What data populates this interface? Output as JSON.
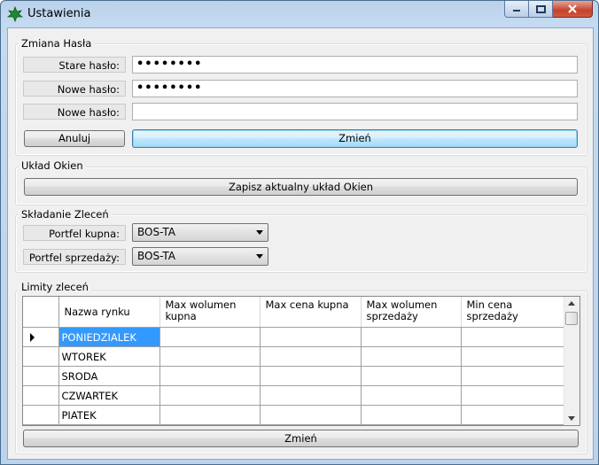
{
  "window": {
    "title": "Ustawienia"
  },
  "password_group": {
    "title": "Zmiana Hasła",
    "old_label": "Stare hasło:",
    "old_value": "••••••••",
    "new_label": "Nowe hasło:",
    "new_value": "••••••••",
    "repeat_label": "Nowe hasło:",
    "repeat_value": "",
    "cancel_label": "Anuluj",
    "change_label": "Zmień"
  },
  "layout_group": {
    "title": "Układ Okien",
    "save_label": "Zapisz aktualny układ Okien"
  },
  "orders_group": {
    "title": "Składanie Zleceń",
    "buy_label": "Portfel kupna:",
    "buy_value": "BOS-TA",
    "sell_label": "Portfel sprzedaży:",
    "sell_value": "BOS-TA"
  },
  "limits_group": {
    "title": "Limity zleceń",
    "columns": [
      "Nazwa rynku",
      "Max wolumen kupna",
      "Max cena kupna",
      "Max wolumen sprzedaży",
      "Min cena sprzedaży"
    ],
    "rows": [
      "PONIEDZIALEK",
      "WTOREK",
      "SRODA",
      "CZWARTEK",
      "PIATEK"
    ],
    "change_label": "Zmień"
  },
  "colors": {
    "selection": "#3399ff",
    "focus_border": "#3c7fb1",
    "close_button": "#c4422c"
  }
}
